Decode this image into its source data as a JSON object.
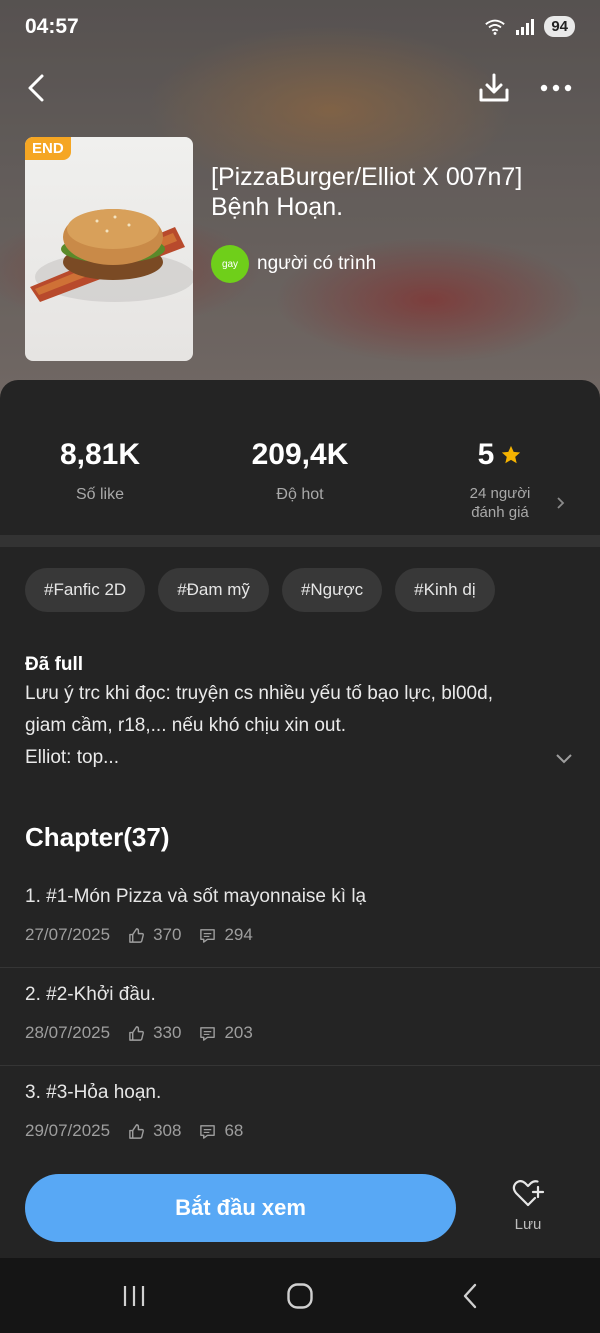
{
  "status_bar": {
    "time": "04:57",
    "battery": "94"
  },
  "cover": {
    "badge": "END"
  },
  "story": {
    "title": "[PizzaBurger/Elliot X 007n7] Bệnh Hoạn.",
    "author_avatar_text": "gay",
    "author_name": "người có trình"
  },
  "stats": {
    "likes_value": "8,81K",
    "likes_label": "Số like",
    "hot_value": "209,4K",
    "hot_label": "Độ hot",
    "rating_value": "5",
    "rating_count_line1": "24 người",
    "rating_count_line2": "đánh giá"
  },
  "tags": [
    "#Fanfic 2D",
    "#Đam mỹ",
    "#Ngược",
    "#Kinh dị"
  ],
  "description": {
    "status": "Đã full",
    "line1": "Lưu ý trc khi đọc: truyện cs nhiều yếu tố bạo lực, bl00d,",
    "line2": "giam cầm, r18,... nếu khó chịu xin out.",
    "line3": "Elliot: top..."
  },
  "chapters_heading": "Chapter(37)",
  "chapters": [
    {
      "title": "1. #1-Món Pizza và sốt mayonnaise kì lạ",
      "date": "27/07/2025",
      "likes": "370",
      "comments": "294"
    },
    {
      "title": "2. #2-Khởi đầu.",
      "date": "28/07/2025",
      "likes": "330",
      "comments": "203"
    },
    {
      "title": "3. #3-Hỏa hoạn.",
      "date": "29/07/2025",
      "likes": "308",
      "comments": "68"
    }
  ],
  "actions": {
    "start_label": "Bắt đầu xem",
    "save_label": "Lưu"
  },
  "colors": {
    "accent": "#58a8f5",
    "badge": "#f5a623",
    "star": "#f5b301",
    "avatar": "#6fcf1a"
  }
}
